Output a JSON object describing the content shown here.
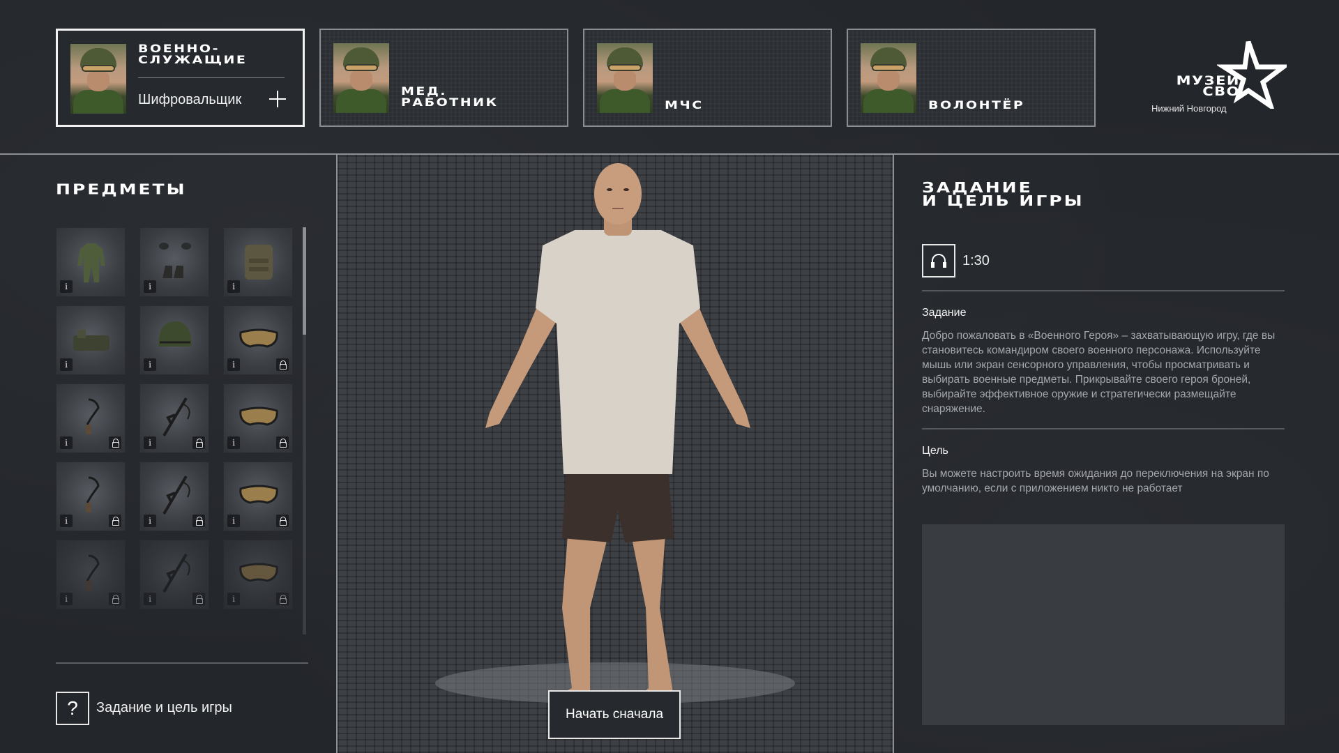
{
  "roles": [
    {
      "title": "Военно-\nслужащие",
      "subtitle": "Шифровальщик",
      "active": true
    },
    {
      "title": "Мед.\nработник",
      "active": false
    },
    {
      "title": "МЧС",
      "active": false
    },
    {
      "title": "Волонтёр",
      "active": false
    }
  ],
  "logo": {
    "title": "МУЗЕЙ\nСВО",
    "city": "Нижний Новгород"
  },
  "items_panel": {
    "title": "Предметы",
    "items": [
      {
        "icon": "uniform-icon",
        "locked": false
      },
      {
        "icon": "gloves-boots-icon",
        "locked": false
      },
      {
        "icon": "plate-carrier-icon",
        "locked": false
      },
      {
        "icon": "chest-rig-icon",
        "locked": false
      },
      {
        "icon": "helmet-icon",
        "locked": false
      },
      {
        "icon": "goggles-icon",
        "locked": true
      },
      {
        "icon": "headset-icon",
        "locked": true
      },
      {
        "icon": "rifle-icon",
        "locked": true
      },
      {
        "icon": "goggles-icon",
        "locked": true
      },
      {
        "icon": "headset-icon",
        "locked": true
      },
      {
        "icon": "rifle-icon",
        "locked": true
      },
      {
        "icon": "goggles-icon",
        "locked": true
      },
      {
        "icon": "headset-icon",
        "locked": true
      },
      {
        "icon": "rifle-icon",
        "locked": true
      },
      {
        "icon": "goggles-icon",
        "locked": true
      }
    ],
    "info_glyph": "i",
    "help_glyph": "?",
    "help_label": "Задание и цель игры"
  },
  "center": {
    "restart_label": "Начать сначала"
  },
  "mission": {
    "title": "Задание\nи цель игры",
    "audio_duration": "1:30",
    "task_heading": "Задание",
    "task_text": "Добро пожаловать в «Военного Героя» – захватывающую игру, где вы становитесь командиром своего военного персонажа. Используйте мышь или экран сенсорного управления, чтобы просматривать и выбирать военные предметы. Прикрывайте своего героя броней, выбирайте эффективное оружие и стратегически размещайте снаряжение.",
    "goal_heading": "Цель",
    "goal_text": "Вы можете настроить время ожидания до переключения на экран по умолчанию, если с приложением никто не работает"
  }
}
